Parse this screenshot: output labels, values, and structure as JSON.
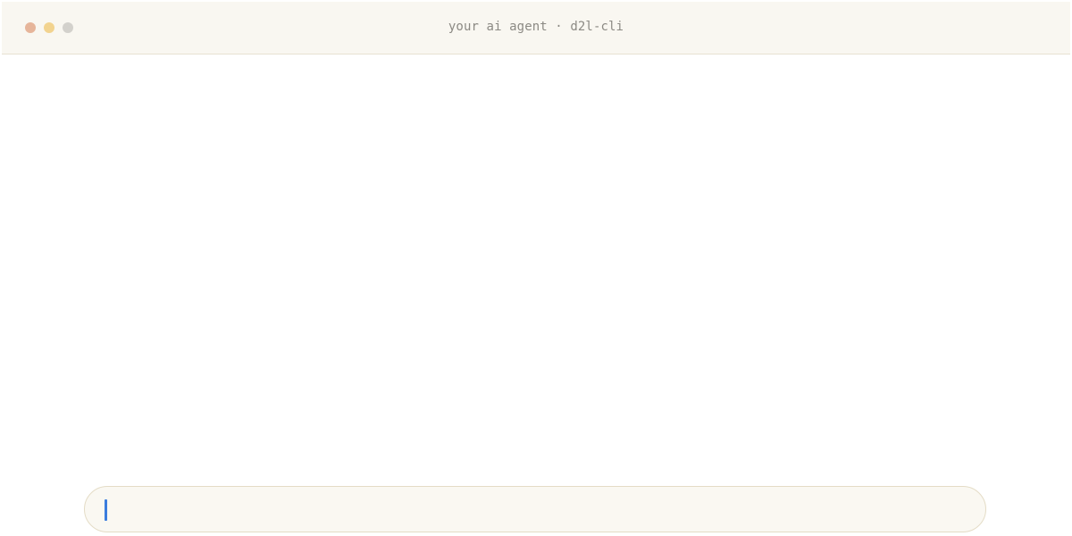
{
  "window": {
    "title": "your ai agent · d2l-cli",
    "controls": [
      {
        "name": "close",
        "color": "#e6b59a"
      },
      {
        "name": "minimize",
        "color": "#f2d38f"
      },
      {
        "name": "maximize",
        "color": "#d3d1cc"
      }
    ]
  },
  "composer": {
    "value": "",
    "placeholder": "",
    "caret_color": "#3b7ddd"
  },
  "colors": {
    "titlebar_bg": "#f9f7f1",
    "composer_border": "#e4dcc6",
    "title_text": "#8c8a84"
  }
}
